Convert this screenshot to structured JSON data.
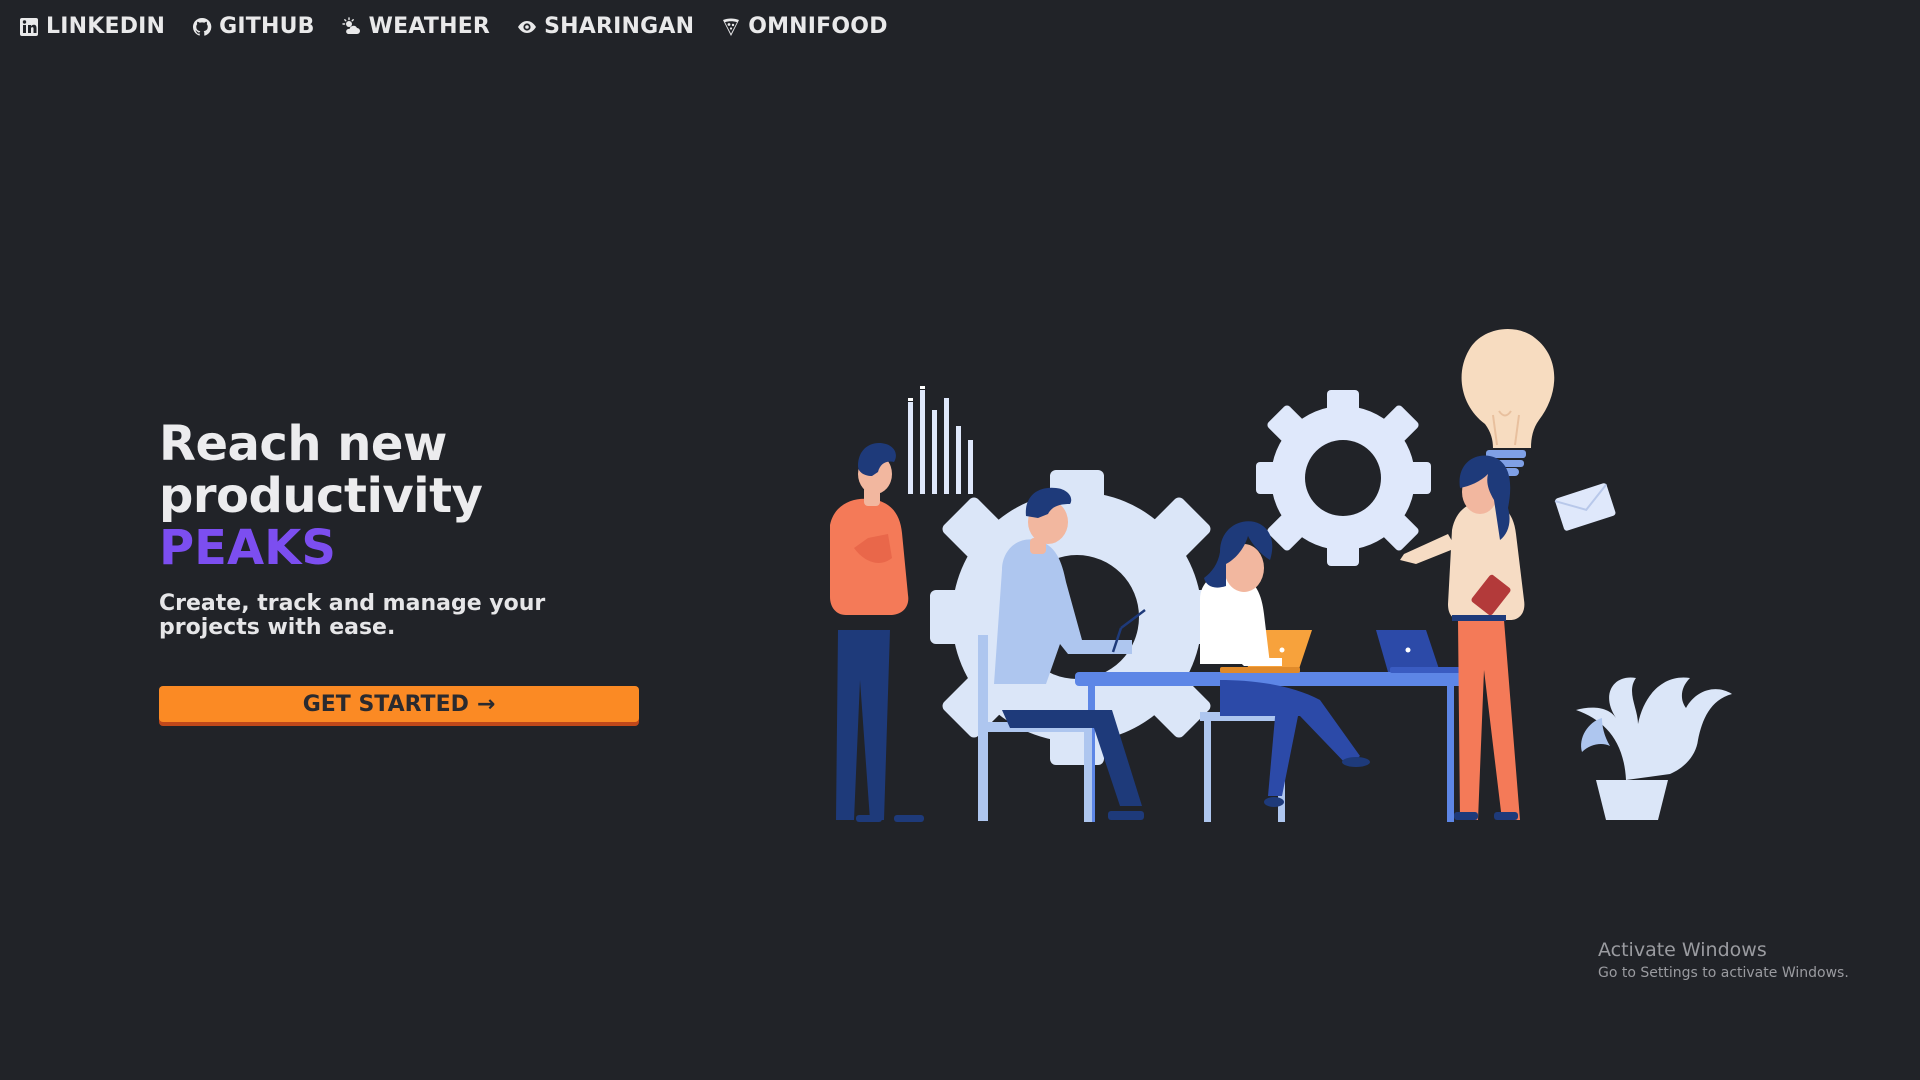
{
  "nav": {
    "items": [
      {
        "label": "LINKEDIN",
        "icon": "linkedin-icon"
      },
      {
        "label": "GITHUB",
        "icon": "github-icon"
      },
      {
        "label": "WEATHER",
        "icon": "weather-icon"
      },
      {
        "label": "SHARINGAN",
        "icon": "eye-icon"
      },
      {
        "label": "OMNIFOOD",
        "icon": "pizza-icon"
      }
    ]
  },
  "hero": {
    "headline_line1": "Reach new",
    "headline_line2": "productivity",
    "headline_accent": "PEAKS",
    "subtitle": "Create, track and manage your projects with ease.",
    "cta_label": "GET STARTED",
    "cta_arrow": "→"
  },
  "watermark": {
    "title": "Activate Windows",
    "subtitle": "Go to Settings to activate Windows."
  },
  "colors": {
    "background": "#212328",
    "accent_purple": "#7c4ef0",
    "cta_orange": "#fb8a24",
    "cta_shadow": "#c0481a",
    "text_light": "#ececee"
  }
}
